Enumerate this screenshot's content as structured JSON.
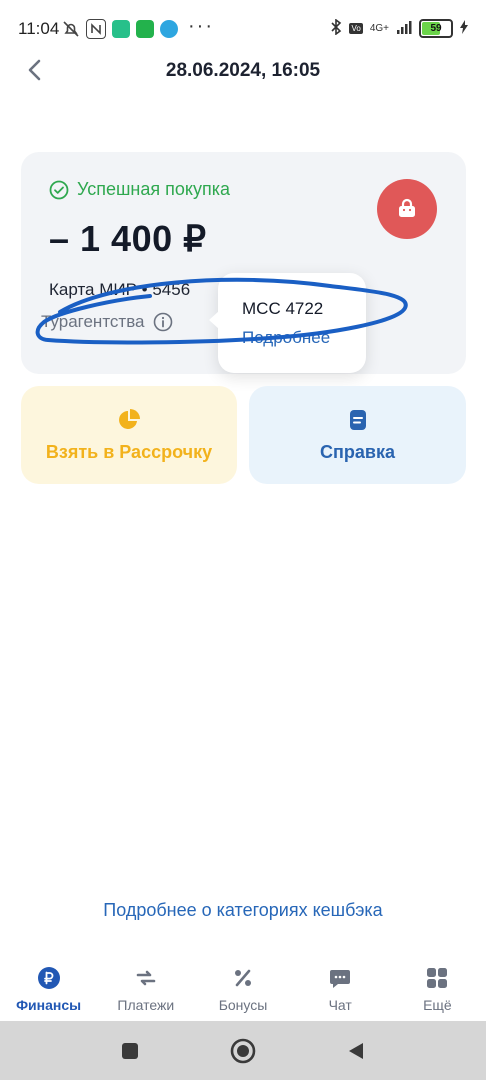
{
  "status_bar": {
    "time": "11:04",
    "network": "4G+",
    "battery": "59"
  },
  "header": {
    "title": "28.06.2024, 16:05"
  },
  "transaction": {
    "status": "Успешная покупка",
    "amount": "– 1 400 ₽",
    "card": "Карта МИР • 5456",
    "category": "Турагентства"
  },
  "tooltip": {
    "mcc": "MCC 4722",
    "link": "Подробнее"
  },
  "actions": {
    "installment": "Взять в Рассрочку",
    "help": "Справка"
  },
  "cashback_link": "Подробнее о категориях кешбэка",
  "bottom_nav": {
    "items": [
      {
        "label": "Финансы",
        "icon": "ruble-icon",
        "active": true
      },
      {
        "label": "Платежи",
        "icon": "transfer-arrows-icon",
        "active": false
      },
      {
        "label": "Бонусы",
        "icon": "percent-icon",
        "active": false
      },
      {
        "label": "Чат",
        "icon": "chat-bubble-icon",
        "active": false
      },
      {
        "label": "Ещё",
        "icon": "grid-icon",
        "active": false
      }
    ]
  },
  "colors": {
    "success": "#2fa84f",
    "accent_blue": "#2258b4",
    "link_blue": "#2767b8",
    "installment_yellow": "#f2b21c",
    "bag_red": "#e05858",
    "annotation_blue": "#1a5fc4"
  }
}
